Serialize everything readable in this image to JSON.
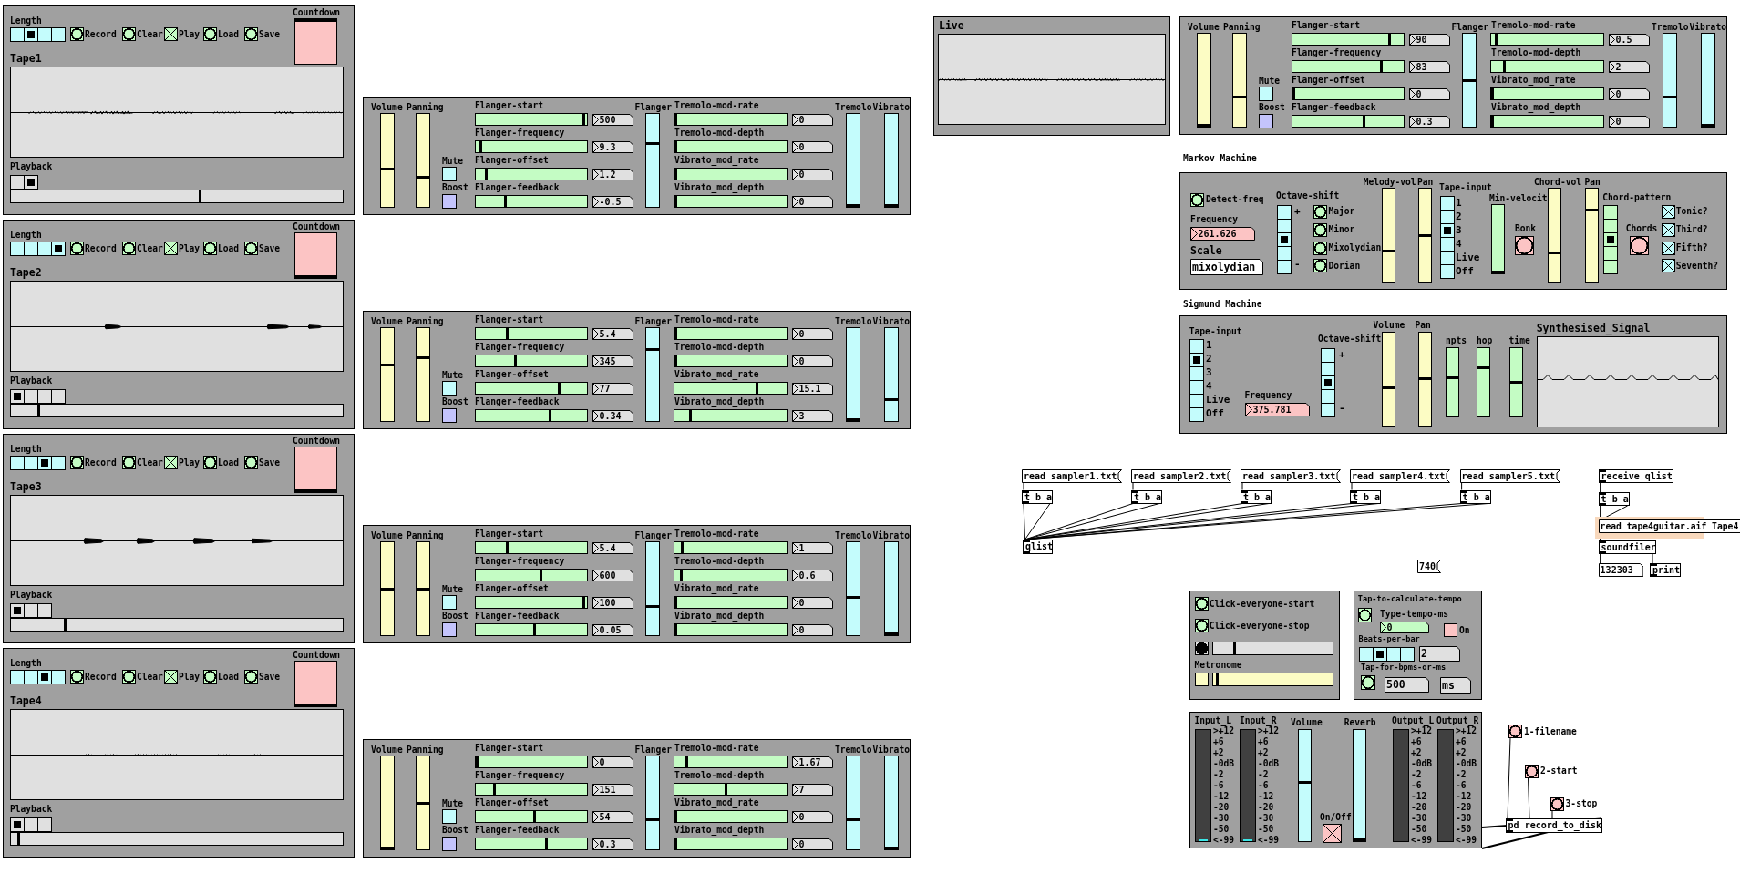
{
  "tapes": [
    {
      "length": {
        "label": "Length",
        "options": [
          {
            "selected": false
          },
          {
            "selected": true
          },
          {
            "selected": false
          },
          {
            "selected": false
          }
        ]
      },
      "controls": [
        {
          "kind": "bang",
          "label": "Record"
        },
        {
          "kind": "bang",
          "label": "Clear"
        },
        {
          "kind": "toggle",
          "label": "Play",
          "checked": true
        },
        {
          "kind": "bang",
          "label": "Load"
        },
        {
          "kind": "bang",
          "label": "Save"
        }
      ],
      "countdown": {
        "label": "Countdown",
        "level": 1
      },
      "title": "Tape1",
      "playback": {
        "label": "Playback",
        "options": [
          {
            "selected": false
          },
          {
            "selected": true
          }
        ]
      },
      "position": {
        "level": 0.57
      },
      "effects": {
        "volume": {
          "label": "Volume",
          "level": 0.4
        },
        "panning": {
          "label": "Panning",
          "level": 0.31
        },
        "mute": {
          "label": "Mute",
          "checked": false
        },
        "boost": {
          "label": "Boost",
          "checked": false
        },
        "flanger_params": [
          {
            "label": "Flanger-start",
            "level": 0.98,
            "value": "500"
          },
          {
            "label": "Flanger-frequency",
            "level": 0.03,
            "value": "9.3"
          },
          {
            "label": "Flanger-offset",
            "level": 0.08,
            "value": "1.2"
          },
          {
            "label": "Flanger-feedback",
            "level": 0.26,
            "value": "-0.5"
          }
        ],
        "flanger": {
          "label": "Flanger",
          "level": 0.69
        },
        "mod_params": [
          {
            "label": "Tremolo-mod-rate",
            "level": 0,
            "value": "0"
          },
          {
            "label": "Tremolo-mod-depth",
            "level": 0,
            "value": "0"
          },
          {
            "label": "Vibrato_mod_rate",
            "level": 0,
            "value": "0"
          },
          {
            "label": "Vibrato_mod_depth",
            "level": 0,
            "value": "0"
          }
        ],
        "tremolo": {
          "label": "Tremolo",
          "level": 0
        },
        "vibrato": {
          "label": "Vibrato",
          "level": 0
        }
      }
    },
    {
      "length": {
        "label": "Length",
        "options": [
          {
            "selected": false
          },
          {
            "selected": false
          },
          {
            "selected": false
          },
          {
            "selected": true
          }
        ]
      },
      "controls": [
        {
          "kind": "bang",
          "label": "Record"
        },
        {
          "kind": "bang",
          "label": "Clear"
        },
        {
          "kind": "toggle",
          "label": "Play",
          "checked": true
        },
        {
          "kind": "bang",
          "label": "Load"
        },
        {
          "kind": "bang",
          "label": "Save"
        }
      ],
      "countdown": {
        "label": "Countdown",
        "level": 0
      },
      "title": "Tape2",
      "playback": {
        "label": "Playback",
        "options": [
          {
            "selected": true
          },
          {
            "selected": false
          },
          {
            "selected": false
          },
          {
            "selected": false
          }
        ]
      },
      "position": {
        "level": 0.08
      },
      "effects": {
        "volume": {
          "label": "Volume",
          "level": 0.61
        },
        "panning": {
          "label": "Panning",
          "level": 0.69
        },
        "mute": {
          "label": "Mute",
          "checked": false
        },
        "boost": {
          "label": "Boost",
          "checked": false
        },
        "flanger_params": [
          {
            "label": "Flanger-start",
            "level": 0.28,
            "value": "5.4"
          },
          {
            "label": "Flanger-frequency",
            "level": 0.35,
            "value": "345"
          },
          {
            "label": "Flanger-offset",
            "level": 0.76,
            "value": "77"
          },
          {
            "label": "Flanger-feedback",
            "level": 0.67,
            "value": "0.34"
          }
        ],
        "flanger": {
          "label": "Flanger",
          "level": 0.78
        },
        "mod_params": [
          {
            "label": "Tremolo-mod-rate",
            "level": 0,
            "value": "0"
          },
          {
            "label": "Tremolo-mod-depth",
            "level": 0,
            "value": "0"
          },
          {
            "label": "Vibrato_mod_rate",
            "level": 0.74,
            "value": "15.1"
          },
          {
            "label": "Vibrato_mod_depth",
            "level": 0.13,
            "value": "3"
          }
        ],
        "tremolo": {
          "label": "Tremolo",
          "level": 0
        },
        "vibrato": {
          "label": "Vibrato",
          "level": 0.22
        }
      }
    },
    {
      "length": {
        "label": "Length",
        "options": [
          {
            "selected": false
          },
          {
            "selected": false
          },
          {
            "selected": true
          },
          {
            "selected": false
          }
        ]
      },
      "controls": [
        {
          "kind": "bang",
          "label": "Record"
        },
        {
          "kind": "bang",
          "label": "Clear"
        },
        {
          "kind": "toggle",
          "label": "Play",
          "checked": true
        },
        {
          "kind": "bang",
          "label": "Load"
        },
        {
          "kind": "bang",
          "label": "Save"
        }
      ],
      "countdown": {
        "label": "Countdown",
        "level": 0
      },
      "title": "Tape3",
      "playback": {
        "label": "Playback",
        "options": [
          {
            "selected": true
          },
          {
            "selected": false
          },
          {
            "selected": false
          }
        ]
      },
      "position": {
        "level": 0.16
      },
      "effects": {
        "volume": {
          "label": "Volume",
          "level": 0.5
        },
        "panning": {
          "label": "Panning",
          "level": 0.5
        },
        "mute": {
          "label": "Mute",
          "checked": false
        },
        "boost": {
          "label": "Boost",
          "checked": false
        },
        "flanger_params": [
          {
            "label": "Flanger-start",
            "level": 0.28,
            "value": "5.4"
          },
          {
            "label": "Flanger-frequency",
            "level": 0.59,
            "value": "600"
          },
          {
            "label": "Flanger-offset",
            "level": 0.98,
            "value": "100"
          },
          {
            "label": "Flanger-feedback",
            "level": 0.53,
            "value": "0.05"
          }
        ],
        "flanger": {
          "label": "Flanger",
          "level": 0.3
        },
        "mod_params": [
          {
            "label": "Tremolo-mod-rate",
            "level": 0.06,
            "value": "1"
          },
          {
            "label": "Tremolo-mod-depth",
            "level": 0.05,
            "value": "0.6"
          },
          {
            "label": "Vibrato_mod_rate",
            "level": 0,
            "value": "0"
          },
          {
            "label": "Vibrato_mod_depth",
            "level": 0,
            "value": "0"
          }
        ],
        "tremolo": {
          "label": "Tremolo",
          "level": 0.4
        },
        "vibrato": {
          "label": "Vibrato",
          "level": 0
        }
      }
    },
    {
      "length": {
        "label": "Length",
        "options": [
          {
            "selected": false
          },
          {
            "selected": false
          },
          {
            "selected": true
          },
          {
            "selected": false
          }
        ]
      },
      "controls": [
        {
          "kind": "bang",
          "label": "Record"
        },
        {
          "kind": "bang",
          "label": "Clear"
        },
        {
          "kind": "toggle",
          "label": "Play",
          "checked": true
        },
        {
          "kind": "bang",
          "label": "Load"
        },
        {
          "kind": "bang",
          "label": "Save"
        }
      ],
      "countdown": {
        "label": "Countdown",
        "level": 0
      },
      "title": "Tape4",
      "playback": {
        "label": "Playback",
        "options": [
          {
            "selected": true
          },
          {
            "selected": false
          },
          {
            "selected": false
          }
        ]
      },
      "position": {
        "level": 0.02
      },
      "effects": {
        "volume": {
          "label": "Volume",
          "level": 0
        },
        "panning": {
          "label": "Panning",
          "level": 0.5
        },
        "mute": {
          "label": "Mute",
          "checked": false
        },
        "boost": {
          "label": "Boost",
          "checked": false
        },
        "flanger_params": [
          {
            "label": "Flanger-start",
            "level": 0,
            "value": "0"
          },
          {
            "label": "Flanger-frequency",
            "level": 0.16,
            "value": "151"
          },
          {
            "label": "Flanger-offset",
            "level": 0.53,
            "value": "54"
          },
          {
            "label": "Flanger-feedback",
            "level": 0.64,
            "value": "0.3"
          }
        ],
        "flanger": {
          "label": "Flanger",
          "level": 0.31
        },
        "mod_params": [
          {
            "label": "Tremolo-mod-rate",
            "level": 0.1,
            "value": "1.67"
          },
          {
            "label": "Tremolo-mod-depth",
            "level": 0.46,
            "value": "7"
          },
          {
            "label": "Vibrato_mod_rate",
            "level": 0,
            "value": "0"
          },
          {
            "label": "Vibrato_mod_depth",
            "level": 0,
            "value": "0"
          }
        ],
        "tremolo": {
          "label": "Tremolo",
          "level": 0.31
        },
        "vibrato": {
          "label": "Vibrato",
          "level": 0
        }
      }
    }
  ],
  "live": {
    "title": "Live",
    "effects": {
      "volume": {
        "label": "Volume",
        "level": 0
      },
      "panning": {
        "label": "Panning",
        "level": 0.31
      },
      "mute": {
        "label": "Mute",
        "checked": false
      },
      "boost": {
        "label": "Boost",
        "checked": false
      },
      "flanger_params": [
        {
          "label": "Flanger-start",
          "level": 0.88,
          "value": "90"
        },
        {
          "label": "Flanger-frequency",
          "level": 0.81,
          "value": "83"
        },
        {
          "label": "Flanger-offset",
          "level": 0,
          "value": "0"
        },
        {
          "label": "Flanger-feedback",
          "level": 0.65,
          "value": "0.3"
        }
      ],
      "flanger": {
        "label": "Flanger",
        "level": 0.5
      },
      "mod_params": [
        {
          "label": "Tremolo-mod-rate",
          "level": 0.03,
          "value": "0.5"
        },
        {
          "label": "Tremolo-mod-depth",
          "level": 0.11,
          "value": "2"
        },
        {
          "label": "Vibrato_mod_rate",
          "level": 0,
          "value": "0"
        },
        {
          "label": "Vibrato_mod_depth",
          "level": 0,
          "value": "0"
        }
      ],
      "tremolo": {
        "label": "Tremolo",
        "level": 0.31
      },
      "vibrato": {
        "label": "Vibrato",
        "level": 0
      }
    }
  },
  "markov": {
    "title": "Markov Machine",
    "detect": {
      "label": "Detect-freq"
    },
    "frequency": {
      "label": "Frequency",
      "value": "261.626"
    },
    "scale": {
      "label": "Scale",
      "value": "mixolydian"
    },
    "octave": {
      "label": "Octave-shift",
      "up": "+",
      "down": "-",
      "options": [
        {
          "selected": false
        },
        {
          "selected": false
        },
        {
          "selected": true
        },
        {
          "selected": false
        },
        {
          "selected": false
        }
      ]
    },
    "scales": [
      {
        "label": "Major"
      },
      {
        "label": "Minor"
      },
      {
        "label": "Mixolydian"
      },
      {
        "label": "Dorian"
      }
    ],
    "melody_volume": {
      "label": "Melody-vol",
      "level": 0.32
    },
    "melody_pan": {
      "label": "Pan",
      "level": 0.49
    },
    "tape_input": {
      "label": "Tape-input",
      "options": [
        {
          "label": "1",
          "selected": false
        },
        {
          "label": "2",
          "selected": false
        },
        {
          "label": "3",
          "selected": true
        },
        {
          "label": "4",
          "selected": false
        },
        {
          "label": "Live",
          "selected": false
        },
        {
          "label": "Off",
          "selected": false
        }
      ]
    },
    "min_velocity": {
      "label": "Min-velocit",
      "level": 0
    },
    "bonk": {
      "label": "Bonk"
    },
    "chord_volume": {
      "label": "Chord-vol",
      "level": 0.3
    },
    "chord_pan": {
      "label": "Pan",
      "level": 0.78
    },
    "chord_pattern": {
      "label": "Chord-pattern",
      "options": [
        {
          "selected": false
        },
        {
          "selected": false
        },
        {
          "selected": true
        },
        {
          "selected": false
        },
        {
          "selected": false
        }
      ]
    },
    "chords": {
      "label": "Chords"
    },
    "intervals": [
      {
        "label": "Tonic?",
        "checked": true
      },
      {
        "label": "Third?",
        "checked": true
      },
      {
        "label": "Fifth?",
        "checked": true
      },
      {
        "label": "Seventh?",
        "checked": true
      }
    ]
  },
  "sigmund": {
    "title": "Sigmund Machine",
    "tape_input": {
      "label": "Tape-input",
      "options": [
        {
          "label": "1",
          "selected": false
        },
        {
          "label": "2",
          "selected": true
        },
        {
          "label": "3",
          "selected": false
        },
        {
          "label": "4",
          "selected": false
        },
        {
          "label": "Live",
          "selected": false
        },
        {
          "label": "Off",
          "selected": false
        }
      ]
    },
    "frequency": {
      "label": "Frequency",
      "value": "375.781"
    },
    "octave": {
      "label": "Octave-shift",
      "up": "+",
      "down": "-",
      "options": [
        {
          "selected": false
        },
        {
          "selected": false
        },
        {
          "selected": true
        },
        {
          "selected": false
        },
        {
          "selected": false
        }
      ]
    },
    "volume": {
      "label": "Volume",
      "level": 0.4
    },
    "pan": {
      "label": "Pan",
      "level": 0.5
    },
    "npts": {
      "label": "npts",
      "level": 0.56
    },
    "hop": {
      "label": "hop",
      "level": 0.71
    },
    "time": {
      "label": "time",
      "level": 0.49
    },
    "signal": {
      "title": "Synthesised_Signal"
    }
  },
  "sampler_loaders": [
    {
      "message": "read sampler1.txt",
      "trigger": "t b a"
    },
    {
      "message": "read sampler2.txt",
      "trigger": "t b a"
    },
    {
      "message": "read sampler3.txt",
      "trigger": "t b a"
    },
    {
      "message": "read sampler4.txt",
      "trigger": "t b a"
    },
    {
      "message": "read sampler5.txt",
      "trigger": "t b a"
    }
  ],
  "qlist": "qlist",
  "counter": "740",
  "loader": {
    "receive": "receive qlist",
    "trigger": "t b a",
    "message": "read tape4guitar.aif Tape4",
    "highlighted": true,
    "soundfiler": "soundfiler",
    "result": "132303",
    "print": "print"
  },
  "click": {
    "start": {
      "label": "Click-everyone-start"
    },
    "stop": {
      "label": "Click-everyone-stop"
    },
    "beat": {
      "active": true,
      "level": 0.17
    },
    "metronome": {
      "label": "Metronome",
      "checked": false,
      "level": 0.02
    }
  },
  "tempo": {
    "title": "Tap-to-calculate-tempo",
    "type": {
      "label": "Type-tempo-ms",
      "value": "0"
    },
    "on": {
      "label": "On",
      "checked": false
    },
    "beats": {
      "label": "Beats-per-bar",
      "options": [
        {
          "selected": false
        },
        {
          "selected": true
        },
        {
          "selected": false
        },
        {
          "selected": false
        }
      ],
      "value": "2"
    },
    "tap": {
      "label": "Tap-for-bpms-or-ms",
      "value": "500",
      "unit": "ms"
    }
  },
  "meters": {
    "channels": [
      {
        "label": "Input_L",
        "level": 0.02,
        "scale": [
          ">+12",
          "+6",
          "+2",
          "-0dB",
          "-2",
          "-6",
          "-12",
          "-20",
          "-30",
          "-50",
          "<-99"
        ]
      },
      {
        "label": "Input_R",
        "level": 0.02,
        "scale": [
          ">+12",
          "+6",
          "+2",
          "-0dB",
          "-2",
          "-6",
          "-12",
          "-20",
          "-30",
          "-50",
          "<-99"
        ]
      },
      {
        "label": "Output_L",
        "scale": [
          ">+12",
          "+6",
          "+2",
          "-0dB",
          "-2",
          "-6",
          "-12",
          "-20",
          "-30",
          "-50",
          "<-99"
        ]
      },
      {
        "label": "Output_R",
        "scale": [
          ">+12",
          "+6",
          "+2",
          "-0dB",
          "-2",
          "-6",
          "-12",
          "-20",
          "-30",
          "-50",
          "<-99"
        ]
      }
    ],
    "volume": {
      "label": "Volume",
      "level": 0.53
    },
    "reverb": {
      "label": "Reverb",
      "level": 0
    },
    "power": {
      "label": "On/Off",
      "checked": true
    }
  },
  "recorder": {
    "controls": [
      {
        "label": "1-filename"
      },
      {
        "label": "2-start"
      },
      {
        "label": "3-stop"
      }
    ],
    "object": "pd record_to_disk"
  }
}
